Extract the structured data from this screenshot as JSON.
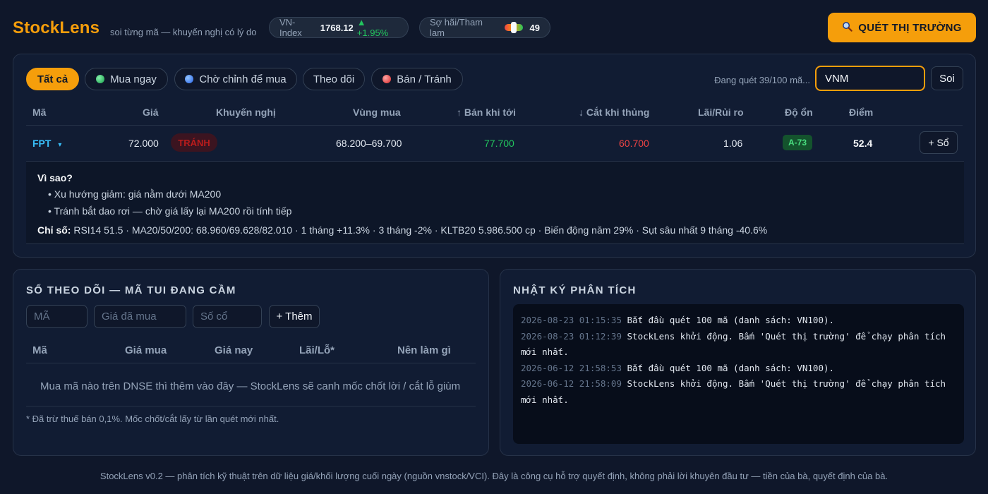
{
  "header": {
    "logo": "StockLens",
    "tagline": "soi từng mã — khuyến nghị có lý do",
    "vnindex": {
      "label": "VN-Index",
      "value": "1768.12",
      "change": "▲ +1.95%"
    },
    "fear_greed": {
      "label": "Sợ hãi/Tham lam",
      "value": "49",
      "level": 0.49
    },
    "scan_button": {
      "icon": "search-icon",
      "label": "QUÉT THỊ TRƯỜNG"
    }
  },
  "filters": [
    {
      "label": "Tất cả",
      "dot": null,
      "active": true
    },
    {
      "label": "Mua ngay",
      "dot": "green",
      "active": false
    },
    {
      "label": "Chờ chỉnh để mua",
      "dot": "blue",
      "active": false
    },
    {
      "label": "Theo dõi",
      "dot": null,
      "active": false
    },
    {
      "label": "Bán / Tránh",
      "dot": "red",
      "active": false
    }
  ],
  "scan_status": "Đang quét 39/100 mã...",
  "search": {
    "value": "VNM",
    "button": "Soi"
  },
  "table": {
    "headers": [
      "Mã",
      "Giá",
      "Khuyến nghị",
      "Vùng mua",
      "↑ Bán khi tới",
      "↓ Cắt khi thủng",
      "Lãi/Rủi ro",
      "Độ ổn",
      "Điểm"
    ],
    "row": {
      "ticker": "FPT",
      "caret": "▾",
      "price": "72.000",
      "recommendation": "TRÁNH",
      "buy_zone": "68.200–69.700",
      "take_profit": "77.700",
      "stop_loss": "60.700",
      "reward_risk": "1.06",
      "stability": "A-73",
      "score": "52.4",
      "add_button": "+ Sổ"
    }
  },
  "detail": {
    "why_title": "Vì sao?",
    "reasons": [
      "• Xu hướng giảm: giá nằm dưới MA200",
      "• Tránh bắt dao rơi — chờ giá lấy lại MA200 rồi tính tiếp"
    ],
    "metrics_label": "Chỉ số:",
    "metrics": "RSI14 51.5 · MA20/50/200: 68.960/69.628/82.010 · 1 tháng +11.3% · 3 tháng -2% · KLTB20 5.986.500 cp · Biến động năm 29% · Sụt sâu nhất 9 tháng -40.6%"
  },
  "book": {
    "title": "SỔ THEO DÕI — MÃ TUI ĐANG CẦM",
    "placeholders": {
      "symbol": "MÃ",
      "buy_price": "Giá đã mua",
      "shares": "Số cổ"
    },
    "add_button": "+ Thêm",
    "headers": [
      "Mã",
      "Giá mua",
      "Giá nay",
      "Lãi/Lỗ*",
      "Nên làm gì"
    ],
    "empty_message": "Mua mã nào trên DNSE thì thêm vào đây — StockLens sẽ canh mốc chốt lời / cắt lỗ giùm",
    "note": "* Đã trừ thuế bán 0,1%. Mốc chốt/cắt lấy từ lần quét mới nhất."
  },
  "log": {
    "title": "NHẬT KÝ PHÂN TÍCH",
    "entries": [
      {
        "ts": "2026-08-23 01:15:35",
        "msg": "Bắt đầu quét 100 mã (danh sách: VN100)."
      },
      {
        "ts": "2026-08-23 01:12:39",
        "msg": "StockLens khởi động. Bấm 'Quét thị trường' để chạy phân tích mới nhất."
      },
      {
        "ts": "2026-06-12 21:58:53",
        "msg": "Bắt đầu quét 100 mã (danh sách: VN100)."
      },
      {
        "ts": "2026-06-12 21:58:09",
        "msg": "StockLens khởi động. Bấm 'Quét thị trường' để chạy phân tích mới nhất."
      }
    ]
  },
  "footer": "StockLens v0.2 — phân tích kỹ thuật trên dữ liệu giá/khối lượng cuối ngày (nguồn vnstock/VCI). Đây là công cụ hỗ trợ quyết định, không phải lời khuyên đầu tư — tiền của bà, quyết định của bà.",
  "colors": {
    "accent": "#f59e0b",
    "background": "#0f172a",
    "up": "#22c55e",
    "down": "#ef4444",
    "ticker": "#38bdf8"
  }
}
